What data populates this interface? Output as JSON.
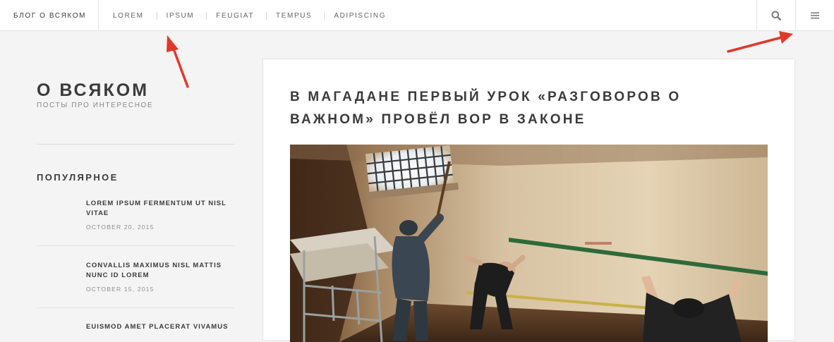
{
  "header": {
    "site_title": "БЛОГ О ВСЯКОМ",
    "nav": [
      "LOREM",
      "IPSUM",
      "FEUGIAT",
      "TEMPUS",
      "ADIPISCING"
    ],
    "search_icon": "search-icon",
    "menu_icon": "hamburger-menu-icon"
  },
  "sidebar": {
    "blog_name": "О ВСЯКОМ",
    "tagline": "ПОСТЫ ПРО ИНТЕРЕСНОЕ",
    "popular_heading": "ПОПУЛЯРНОЕ",
    "posts": [
      {
        "title": "LOREM IPSUM FERMENTUM UT NISL VITAE",
        "date": "OCTOBER 20, 2015"
      },
      {
        "title": "CONVALLIS MAXIMUS NISL MATTIS NUNC ID LOREM",
        "date": "OCTOBER 15, 2015"
      },
      {
        "title": "EUISMOD AMET PLACERAT VIVAMUS",
        "date": ""
      }
    ]
  },
  "article": {
    "title": "В МАГАДАНЕ ПЕРВЫЙ УРОК «РАЗГОВОРОВ О ВАЖНОМ» ПРОВЁЛ ВОР В ЗАКОНЕ"
  },
  "colors": {
    "text_dark": "#3c3b3b",
    "text_muted": "#888888",
    "page_bg": "#f4f4f4",
    "annotation_red": "#e0392b"
  }
}
